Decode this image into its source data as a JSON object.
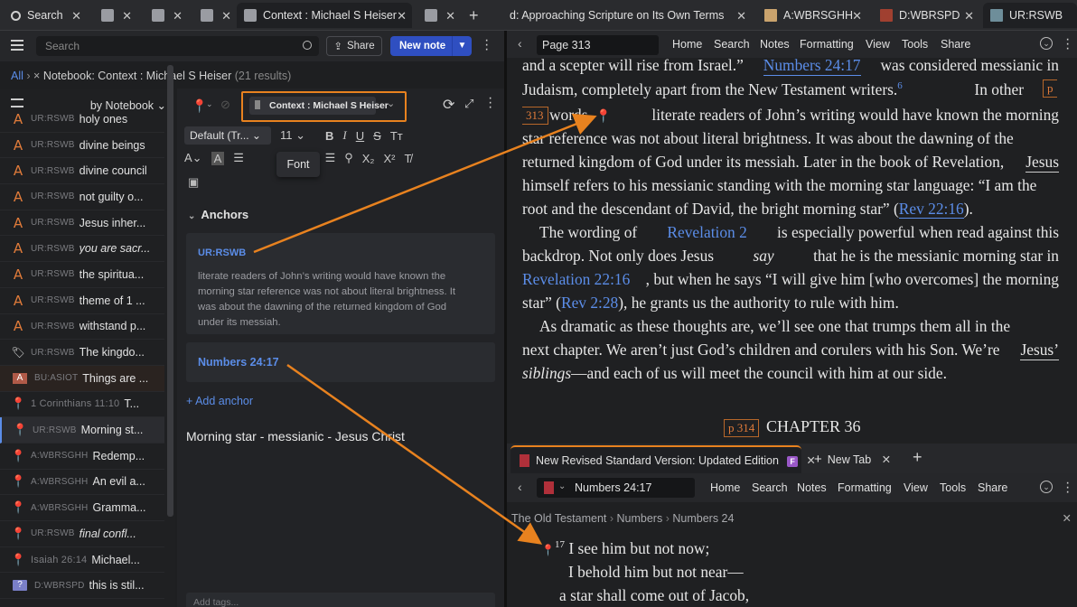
{
  "tabs": [
    {
      "label": "Search",
      "icon": "search-icon"
    },
    {
      "label": "",
      "icon": "doc-icon"
    },
    {
      "label": "",
      "icon": "doc-icon"
    },
    {
      "label": "",
      "icon": "doc-icon"
    },
    {
      "label": "Context : Michael S Heiser",
      "icon": "notebook-icon"
    },
    {
      "label": "",
      "icon": "doc-icon"
    },
    {
      "label": "d: Approaching Scripture on Its Own Terms",
      "icon": "book-icon"
    },
    {
      "label": "A:WBRSGHH",
      "icon": "book-icon"
    },
    {
      "label": "D:WBRSPD",
      "icon": "book-icon"
    },
    {
      "label": "UR:RSWB",
      "icon": "book-icon"
    }
  ],
  "left_toolbar": {
    "search_placeholder": "Search",
    "share_label": "Share",
    "new_note_label": "New note"
  },
  "breadcrumb": {
    "all": "All",
    "notebook": "Notebook: Context : Michael S Heiser",
    "count": "(21 results)"
  },
  "list": {
    "sort_label": "by Notebook",
    "rows": [
      {
        "icon": "A",
        "src": "UR:RSWB",
        "title": "holy ones",
        "italic": false
      },
      {
        "icon": "A",
        "src": "UR:RSWB",
        "title": "divine beings",
        "italic": false
      },
      {
        "icon": "A",
        "src": "UR:RSWB",
        "title": "divine council",
        "italic": false
      },
      {
        "icon": "A",
        "src": "UR:RSWB",
        "title": "not guilty o...",
        "italic": false
      },
      {
        "icon": "A",
        "src": "UR:RSWB",
        "title": "Jesus inher...",
        "italic": false
      },
      {
        "icon": "A",
        "src": "UR:RSWB",
        "title": "you are sacr...",
        "italic": true
      },
      {
        "icon": "A",
        "src": "UR:RSWB",
        "title": "the spiritua...",
        "italic": false
      },
      {
        "icon": "A",
        "src": "UR:RSWB",
        "title": "theme of 1 ...",
        "italic": false
      },
      {
        "icon": "A",
        "src": "UR:RSWB",
        "title": "withstand p...",
        "italic": false
      },
      {
        "icon": "tag",
        "src": "UR:RSWB",
        "title": "The kingdo...",
        "italic": false
      },
      {
        "icon": "box",
        "src": "BU:ASIOT",
        "title": "Things are ...",
        "italic": false
      },
      {
        "icon": "pin",
        "src": "1 Corinthians 11:10",
        "title": "T...",
        "italic": false
      },
      {
        "icon": "pin",
        "src": "UR:RSWB",
        "title": "Morning st...",
        "italic": false
      },
      {
        "icon": "pin",
        "src": "A:WBRSGHH",
        "title": "Redemp...",
        "italic": false
      },
      {
        "icon": "pin",
        "src": "A:WBRSGHH",
        "title": "An evil a...",
        "italic": false
      },
      {
        "icon": "pin",
        "src": "A:WBRSGHH",
        "title": "Gramma...",
        "italic": false
      },
      {
        "icon": "pin",
        "src": "UR:RSWB",
        "title": "final confl...",
        "italic": true
      },
      {
        "icon": "pin-p",
        "src": "Isaiah 26:14",
        "title": "Michael...",
        "italic": false
      },
      {
        "icon": "q",
        "src": "D:WBRSPD",
        "title": "this is stil...",
        "italic": false
      }
    ]
  },
  "editor": {
    "context_label": "Context : Michael S Heiser",
    "font_label": "Default (Tr...",
    "size_label": "11",
    "tooltip": "Font",
    "anchors_heading": "Anchors",
    "anchor1_ref": "UR:RSWB",
    "anchor1_lines": [
      "literate readers of John’s writing would have known the",
      "morning star reference was not about literal brightness. It",
      "was about the dawning of the returned kingdom of God",
      "under its messiah."
    ],
    "anchor2_ref": "Numbers 24:17",
    "add_anchor": "+ Add anchor",
    "note_title": "Morning star - messianic - Jesus Christ",
    "tags_placeholder": "Add tags..."
  },
  "reader": {
    "page": "Page 313",
    "menu": [
      "Home",
      "Search",
      "Notes",
      "Formatting",
      "View",
      "Tools",
      "Share"
    ],
    "page_marker_p": "p",
    "page_marker_313": "313",
    "page_marker_314": "p 314",
    "chapter": "CHAPTER 36",
    "footnote": "6",
    "text": {
      "l0a": "and a scepter will rise from Israel.”",
      "l0link": "Numbers 24:17",
      "l0b": "was considered messianic in",
      "l1a": "Judaism, completely apart from the New Testament writers.",
      "l1b": "In other",
      "l2a": "words,",
      "l2b": "literate readers of John’s writing would have known the morning",
      "l3": "star reference was not about literal brightness. It was about the dawning of the",
      "l4a": "returned kingdom of God under its messiah. Later in the book of Revelation,",
      "l4link": "Jesus",
      "l5": "himself refers to his messianic standing with the morning star language: “I am the",
      "l6a": "root and the descendant of David, the bright morning star” (",
      "l6link": "Rev 22:16",
      "l6b": ").",
      "l7a": "The wording of",
      "l7link": "Revelation 2",
      "l7b": "is especially powerful when read against this",
      "l8": "backdrop. Not only does Jesus",
      "l8it": "say",
      "l8b": "that he is the messianic morning star in",
      "l9link": "Revelation 22:16",
      "l9b": ", but when he says “I will give him [who overcomes] the morning",
      "l10a": "star” (",
      "l10link": "Rev 2:28",
      "l10b": "), he grants us the authority to rule with him.",
      "l11": "As dramatic as these thoughts are, we’ll see one that trumps them all in the",
      "l12a": "next chapter. We aren’t just God’s children and corulers with his Son. We’re",
      "l12link": "Jesus’",
      "l13it": "siblings",
      "l13b": "—and each of us will meet the council with him at our side."
    }
  },
  "bottom": {
    "tab_label": "New Revised Standard Version: Updated Edition",
    "f_badge": "F",
    "new_tab": "New Tab",
    "ref": "Numbers 24:17",
    "menu": [
      "Home",
      "Search",
      "Notes",
      "Formatting",
      "View",
      "Tools",
      "Share"
    ],
    "crumbs": [
      "The Old Testament",
      "Numbers",
      "Numbers 24"
    ],
    "verse_num": "17",
    "lines": [
      "I see him but not now;",
      "I behold him but not near—",
      "a star shall come out of Jacob,"
    ]
  },
  "colors": {
    "accent": "#e8821f",
    "link": "#5b8de8",
    "primary_button": "#2f4fc1",
    "pin": "#d02a33"
  }
}
